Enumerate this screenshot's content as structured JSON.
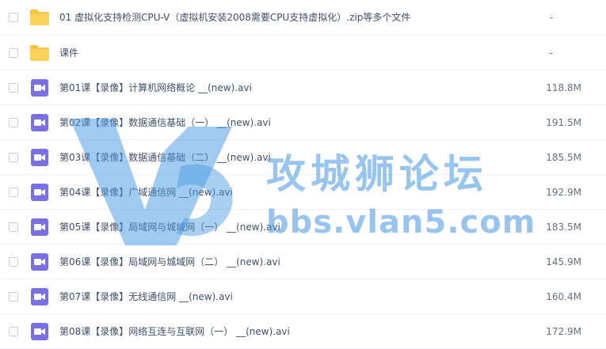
{
  "files": [
    {
      "type": "folder",
      "name": "01 虚拟化支持检测CPU-V（虚拟机安装2008需要CPU支持虚拟化）.zip等多个文件",
      "size": "-"
    },
    {
      "type": "folder",
      "name": "课件",
      "size": "-"
    },
    {
      "type": "video",
      "name": "第01课【录像】计算机网络概论 __(new).avi",
      "size": "118.8M"
    },
    {
      "type": "video",
      "name": "第02课【录像】数据通信基础（一） __(new).avi",
      "size": "191.5M"
    },
    {
      "type": "video",
      "name": "第03课【录像】数据通信基础（二） __(new).avi",
      "size": "185.5M"
    },
    {
      "type": "video",
      "name": "第04课【录像】广域通信网 __(new).avi",
      "size": "192.9M"
    },
    {
      "type": "video",
      "name": "第05课【录像】局域网与城域网（一） __(new).avi",
      "size": "183.5M"
    },
    {
      "type": "video",
      "name": "第06课【录像】局域网与城域网（二） __(new).avi",
      "size": "145.9M"
    },
    {
      "type": "video",
      "name": "第07课【录像】无线通信网 __(new).avi",
      "size": "160.4M"
    },
    {
      "type": "video",
      "name": "第08课【录像】网络互连与互联网（一） __(new).avi",
      "size": "172.9M"
    }
  ],
  "icons": {
    "folder": "folder-icon",
    "video": "video-file-icon"
  },
  "colors": {
    "folder": "#f7c543",
    "video": "#7b6fe6"
  },
  "watermark": {
    "title": "攻城狮论坛",
    "url": "bbs.vlan5.com"
  }
}
